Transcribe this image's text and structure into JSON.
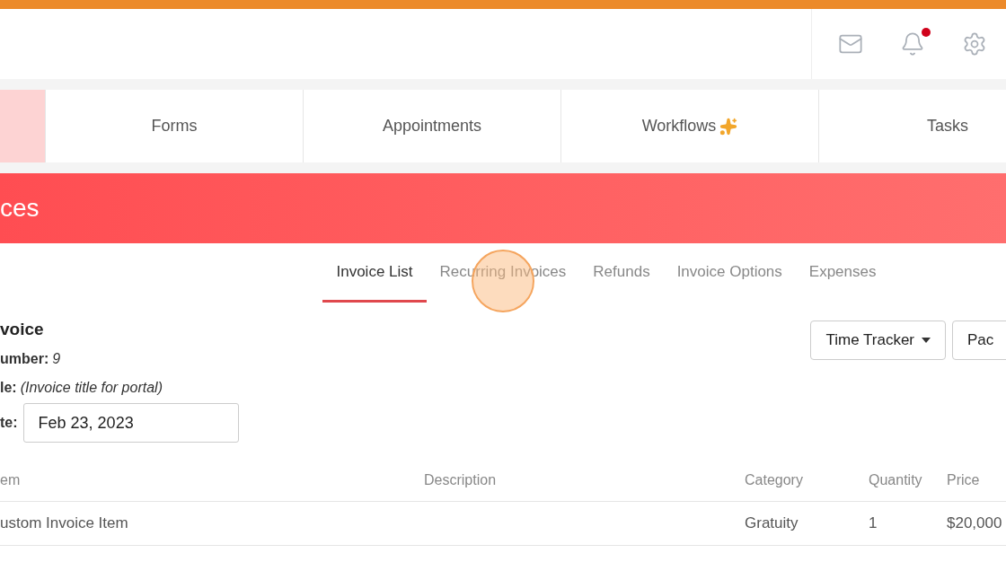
{
  "header": {
    "notification_unread": true
  },
  "nav_tabs": [
    {
      "label": "Forms",
      "selected": false,
      "sparkle": false
    },
    {
      "label": "Appointments",
      "selected": false,
      "sparkle": false
    },
    {
      "label": "Workflows",
      "selected": false,
      "sparkle": true
    },
    {
      "label": "Tasks",
      "selected": false,
      "sparkle": false
    }
  ],
  "banner": {
    "title": "ces"
  },
  "sub_tabs": [
    {
      "label": "Invoice List",
      "selected": true
    },
    {
      "label": "Recurring Invoices",
      "selected": false
    },
    {
      "label": "Refunds",
      "selected": false
    },
    {
      "label": "Invoice Options",
      "selected": false
    },
    {
      "label": "Expenses",
      "selected": false
    }
  ],
  "invoice": {
    "heading": "voice",
    "number_label": "umber:",
    "number": "9",
    "title_label": "le:",
    "title_value": "(Invoice title for portal)",
    "date_label": "te:",
    "date_value": "Feb 23, 2023"
  },
  "buttons": [
    {
      "label": "Time Tracker",
      "dropdown": true
    },
    {
      "label": "Pac",
      "dropdown": false
    }
  ],
  "table": {
    "columns": [
      "em",
      "Description",
      "Category",
      "Quantity",
      "Price"
    ],
    "rows": [
      [
        "ustom Invoice Item",
        "",
        "Gratuity",
        "1",
        "$20,000"
      ]
    ]
  }
}
